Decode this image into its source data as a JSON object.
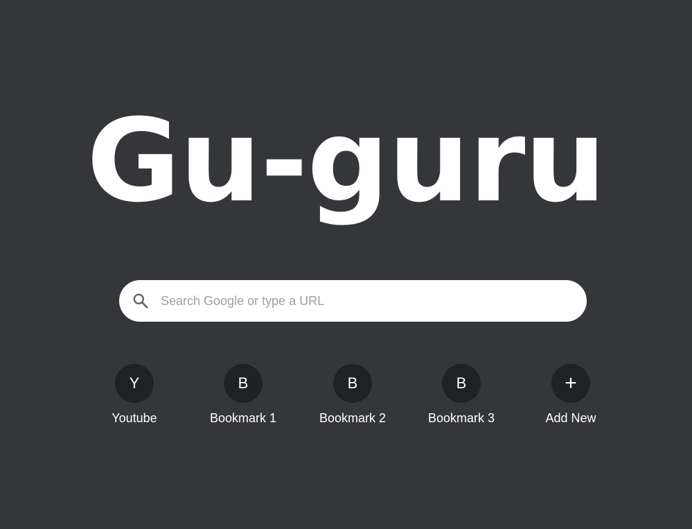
{
  "logo": {
    "text": "Gu-guru"
  },
  "search": {
    "placeholder": "Search Google or type a URL",
    "value": "",
    "icon": "search-icon"
  },
  "shortcuts": [
    {
      "initial": "Y",
      "label": "Youtube"
    },
    {
      "initial": "B",
      "label": "Bookmark 1"
    },
    {
      "initial": "B",
      "label": "Bookmark 2"
    },
    {
      "initial": "B",
      "label": "Bookmark 3"
    },
    {
      "initial": "+",
      "label": "Add New"
    }
  ],
  "colors": {
    "background": "#35363a",
    "search_bg": "#ffffff",
    "shortcut_circle": "#202124",
    "text": "#ffffff",
    "placeholder": "#9aa0a6"
  }
}
